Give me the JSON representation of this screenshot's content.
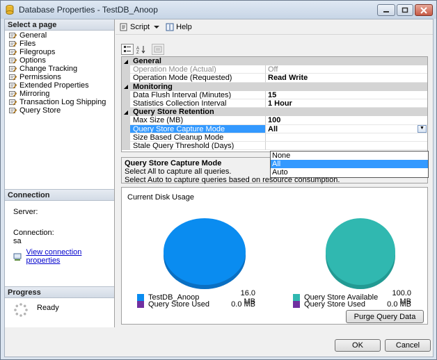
{
  "window": {
    "title": "Database Properties - TestDB_Anoop"
  },
  "left_pane": {
    "select_header": "Select a page",
    "pages": [
      {
        "label": "General"
      },
      {
        "label": "Files"
      },
      {
        "label": "Filegroups"
      },
      {
        "label": "Options"
      },
      {
        "label": "Change Tracking"
      },
      {
        "label": "Permissions"
      },
      {
        "label": "Extended Properties"
      },
      {
        "label": "Mirroring"
      },
      {
        "label": "Transaction Log Shipping"
      },
      {
        "label": "Query Store"
      }
    ],
    "connection_header": "Connection",
    "server_label": "Server:",
    "server_value": "",
    "connection_label": "Connection:",
    "connection_value": "sa",
    "view_conn_link": "View connection properties",
    "progress_header": "Progress",
    "progress_status": "Ready"
  },
  "toolbar": {
    "script_label": "Script",
    "help_label": "Help"
  },
  "property_grid": {
    "categories": [
      {
        "name": "General",
        "rows": [
          {
            "name": "Operation Mode (Actual)",
            "value": "Off",
            "disabled": true
          },
          {
            "name": "Operation Mode (Requested)",
            "value": "Read Write"
          }
        ]
      },
      {
        "name": "Monitoring",
        "rows": [
          {
            "name": "Data Flush Interval (Minutes)",
            "value": "15"
          },
          {
            "name": "Statistics Collection Interval",
            "value": "1 Hour"
          }
        ]
      },
      {
        "name": "Query Store Retention",
        "rows": [
          {
            "name": "Max Size (MB)",
            "value": "100"
          },
          {
            "name": "Query Store Capture Mode",
            "value": "All",
            "selected": true
          },
          {
            "name": "Size Based Cleanup Mode",
            "value": ""
          },
          {
            "name": "Stale Query Threshold (Days)",
            "value": ""
          }
        ]
      }
    ],
    "dropdown_options": [
      "None",
      "All",
      "Auto"
    ],
    "dropdown_selected": "All"
  },
  "description": {
    "title": "Query Store Capture Mode",
    "line1": "Select All to capture all queries.",
    "line2": "Select Auto to capture queries based on resource consumption."
  },
  "disk_usage": {
    "title": "Current Disk Usage",
    "left_legend": [
      {
        "label": "TestDB_Anoop",
        "value": "16.0 MB",
        "color": "#0a8cf0"
      },
      {
        "label": "Query Store Used",
        "value": "0.0 MB",
        "color": "#7030a0"
      }
    ],
    "right_legend": [
      {
        "label": "Query Store Available",
        "value": "100.0 MB",
        "color": "#30b8b0"
      },
      {
        "label": "Query Store Used",
        "value": "0.0 MB",
        "color": "#7030a0"
      }
    ],
    "purge_button": "Purge Query Data"
  },
  "footer": {
    "ok_label": "OK",
    "cancel_label": "Cancel"
  }
}
